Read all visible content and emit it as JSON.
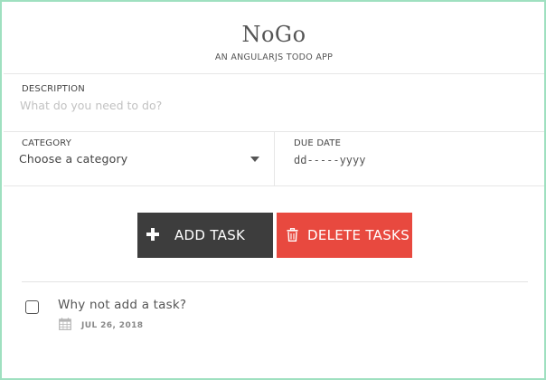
{
  "header": {
    "title": "NoGo",
    "subtitle": "AN ANGULARJS TODO APP"
  },
  "form": {
    "description": {
      "label": "DESCRIPTION",
      "value": "",
      "placeholder": "What do you need to do?"
    },
    "category": {
      "label": "CATEGORY",
      "selected": "Choose a category"
    },
    "due_date": {
      "label": "DUE DATE",
      "value": "dd-----yyyy"
    }
  },
  "actions": {
    "add_label": "ADD TASK",
    "delete_label": "DELETE TASKS"
  },
  "tasks": [
    {
      "title": "Why not add a task?",
      "date": "JUL 26, 2018",
      "checked": false
    }
  ],
  "colors": {
    "frame_border": "#9fe0c0",
    "add_button": "#3d3d3d",
    "delete_button": "#e8493f"
  },
  "icons": {
    "add": "plus-icon",
    "delete": "trash-icon",
    "category": "chevron-down-icon",
    "date": "calendar-icon"
  }
}
